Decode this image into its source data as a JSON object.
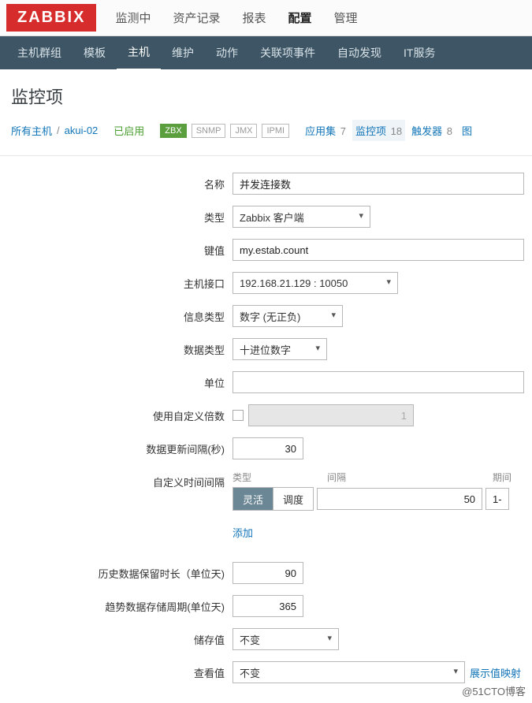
{
  "logo": "ZABBIX",
  "topnav": {
    "monitor": "监测中",
    "inventory": "资产记录",
    "reports": "报表",
    "config": "配置",
    "admin": "管理"
  },
  "subnav": {
    "hostgroup": "主机群组",
    "template": "模板",
    "host": "主机",
    "maint": "维护",
    "action": "动作",
    "correlation": "关联项事件",
    "discovery": "自动发现",
    "itservice": "IT服务"
  },
  "page_title": "监控项",
  "crumb": {
    "all_hosts": "所有主机",
    "host": "akui-02",
    "status": "已启用"
  },
  "badges": {
    "zbx": "ZBX",
    "snmp": "SNMP",
    "jmx": "JMX",
    "ipmi": "IPMI"
  },
  "tabs": {
    "apps": {
      "label": "应用集",
      "count": "7"
    },
    "items": {
      "label": "监控项",
      "count": "18"
    },
    "triggers": {
      "label": "触发器",
      "count": "8"
    },
    "graphs": {
      "label": "图"
    }
  },
  "form": {
    "name": {
      "label": "名称",
      "value": "并发连接数"
    },
    "type": {
      "label": "类型",
      "value": "Zabbix 客户端"
    },
    "key": {
      "label": "键值",
      "value": "my.estab.count"
    },
    "iface": {
      "label": "主机接口",
      "value": "192.168.21.129 : 10050"
    },
    "info_type": {
      "label": "信息类型",
      "value": "数字 (无正负)"
    },
    "data_type": {
      "label": "数据类型",
      "value": "十进位数字"
    },
    "unit": {
      "label": "单位",
      "value": ""
    },
    "multiplier": {
      "label": "使用自定义倍数",
      "value": "1"
    },
    "update_interval": {
      "label": "数据更新间隔(秒)",
      "value": "30"
    },
    "custom_interval": {
      "label": "自定义时间间隔",
      "header_type": "类型",
      "header_interval": "间隔",
      "header_period": "期间",
      "seg_flex": "灵活",
      "seg_sched": "调度",
      "interval_value": "50",
      "period_value": "1-",
      "add": "添加"
    },
    "history": {
      "label": "历史数据保留时长（单位天)",
      "value": "90"
    },
    "trends": {
      "label": "趋势数据存储周期(单位天)",
      "value": "365"
    },
    "store": {
      "label": "储存值",
      "value": "不变"
    },
    "show": {
      "label": "查看值",
      "value": "不变",
      "link": "展示值映射"
    }
  },
  "watermark": "@51CTO博客"
}
